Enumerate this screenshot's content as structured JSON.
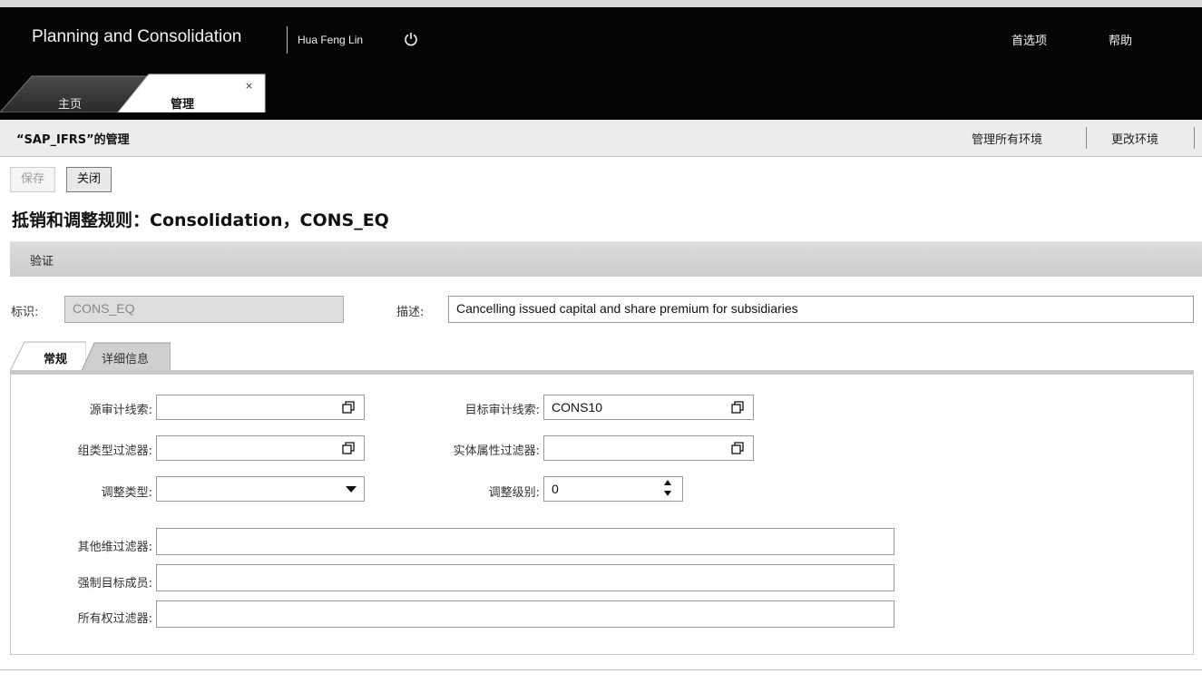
{
  "app": {
    "title": "Planning and Consolidation",
    "user": "Hua Feng Lin",
    "preferences": "首选项",
    "help": "帮助"
  },
  "tabs": [
    {
      "label": "主页"
    },
    {
      "label": "管理",
      "close": "×"
    }
  ],
  "env_bar": {
    "title": "“SAP_IFRS”的管理",
    "manage_all": "管理所有环境",
    "change": "更改环境"
  },
  "toolbar": {
    "save": "保存",
    "close": "关闭"
  },
  "page_title": "抵销和调整规则：Consolidation，CONS_EQ",
  "section": {
    "verify": "验证"
  },
  "identity": {
    "id_label": "标识:",
    "id_value": "CONS_EQ",
    "desc_label": "描述:",
    "desc_value": "Cancelling issued capital and share premium for subsidiaries"
  },
  "subtabs": {
    "general": "常规",
    "details": "详细信息"
  },
  "form": {
    "source_audit_label": "源审计线索:",
    "source_audit_value": "",
    "target_audit_label": "目标审计线索:",
    "target_audit_value": "CONS10",
    "group_type_filter_label": "组类型过滤器:",
    "group_type_filter_value": "",
    "entity_prop_filter_label": "实体属性过滤器:",
    "entity_prop_filter_value": "",
    "adjust_type_label": "调整类型:",
    "adjust_type_value": "",
    "adjust_level_label": "调整级别:",
    "adjust_level_value": "0",
    "other_dim_filter_label": "其他维过滤器:",
    "other_dim_filter_value": "",
    "force_target_label": "强制目标成员:",
    "force_target_value": "",
    "ownership_filter_label": "所有权过滤器:",
    "ownership_filter_value": ""
  },
  "icons": {
    "power": "power-icon",
    "value_help": "value-help-icon",
    "dropdown": "chevron-down-icon",
    "spinner": "spinner-icon"
  }
}
